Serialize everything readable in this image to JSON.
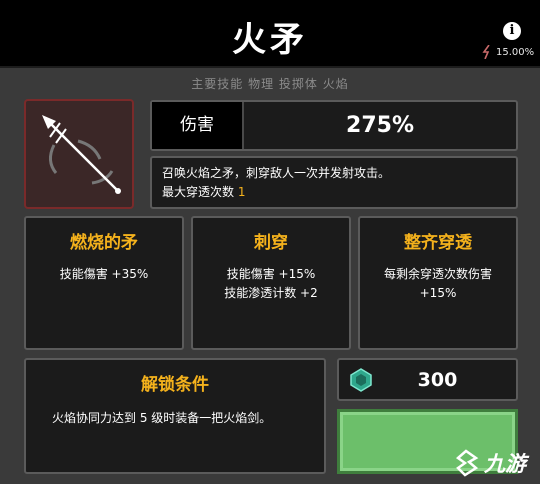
{
  "header": {
    "title": "火矛",
    "info_icon": "info-icon",
    "stat_icon": "lightning-bolt-icon",
    "stat_value": "15.00%"
  },
  "tags": "主要技能  物理  投掷体  火焰",
  "skill_icon": "fire-spear-icon",
  "damage": {
    "label": "伤害",
    "value": "275%"
  },
  "description": {
    "line1": "召唤火焰之矛，刺穿敌人一次并发射攻击。",
    "line2_prefix": "最大穿透次数",
    "line2_value": "1"
  },
  "upgrades": [
    {
      "title": "燃烧的矛",
      "lines": [
        "技能傷害 +35%"
      ]
    },
    {
      "title": "刺穿",
      "lines": [
        "技能傷害 +15%",
        "技能渗透计数 +2"
      ]
    },
    {
      "title": "整齐穿透",
      "lines": [
        "每剩余穿透次数伤害",
        "+15%"
      ]
    }
  ],
  "unlock": {
    "title": "解锁条件",
    "text": "火焰协同力达到 5 级时装备一把火焰剑。"
  },
  "cost": {
    "icon": "gem-icon",
    "value": "300"
  },
  "watermark": {
    "logo": "9game-logo",
    "text": "九游"
  },
  "colors": {
    "accent": "#f5b21c",
    "background": "#3a3a3a",
    "panel": "#1b1b1b",
    "buy_button": "#6cbf6a"
  }
}
